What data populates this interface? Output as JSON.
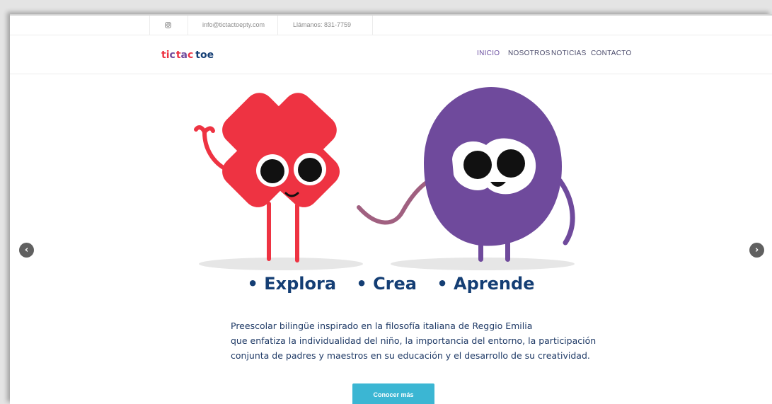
{
  "topbar": {
    "instagram_icon": "instagram-icon",
    "email": "info@tictactoepty.com",
    "phone": "Llámanos: 831-7759"
  },
  "header": {
    "logo_text": "tictactoe",
    "nav": [
      {
        "label": "INICIO",
        "active": true
      },
      {
        "label": "NOSOTROS",
        "active": false
      },
      {
        "label": "NOTICIAS",
        "active": false
      },
      {
        "label": "CONTACTO",
        "active": false
      }
    ]
  },
  "hero": {
    "tagline": [
      "• Explora",
      "• Crea",
      "• Aprende"
    ],
    "description": [
      "Preescolar bilingüe inspirado en la filosofía italiana de Reggio Emilia",
      "que enfatiza la individualidad del niño, la importancia del entorno, la participación",
      "conjunta de padres y maestros en su educación y el desarrollo de su creatividad."
    ],
    "cta_label": "Conocer más",
    "prev_icon": "chevron-left-icon",
    "next_icon": "chevron-right-icon"
  },
  "colors": {
    "red_character": "#ee3342",
    "purple_character": "#6f4a9c",
    "tagline": "#143e74",
    "cta": "#3bb6d3",
    "nav_active": "#6b4fa1"
  }
}
